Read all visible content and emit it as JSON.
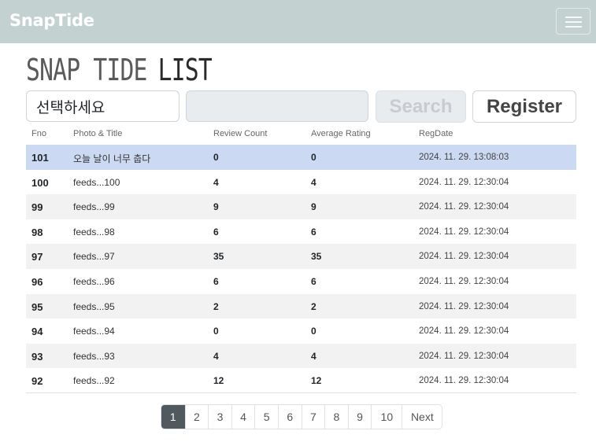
{
  "app": {
    "brand": "SnapTide"
  },
  "page": {
    "title_part1": "SNAP TIDE",
    "title_part2": "LIST"
  },
  "search": {
    "type_select_value": "선택하세요",
    "keyword_value": "",
    "search_label": "Search",
    "register_label": "Register"
  },
  "table": {
    "headers": {
      "fno": "Fno",
      "title": "Photo & Title",
      "review_count": "Review Count",
      "avg_rating": "Average Rating",
      "regdate": "RegDate"
    },
    "rows": [
      {
        "fno": "101",
        "title": "오늘 날이 너무 춥다",
        "review_count": "0",
        "avg_rating": "0",
        "regdate": "2024. 11. 29. 13:08:03",
        "selected": true
      },
      {
        "fno": "100",
        "title": "feeds...100",
        "review_count": "4",
        "avg_rating": "4",
        "regdate": "2024. 11. 29. 12:30:04"
      },
      {
        "fno": "99",
        "title": "feeds...99",
        "review_count": "9",
        "avg_rating": "9",
        "regdate": "2024. 11. 29. 12:30:04"
      },
      {
        "fno": "98",
        "title": "feeds...98",
        "review_count": "6",
        "avg_rating": "6",
        "regdate": "2024. 11. 29. 12:30:04"
      },
      {
        "fno": "97",
        "title": "feeds...97",
        "review_count": "35",
        "avg_rating": "35",
        "regdate": "2024. 11. 29. 12:30:04"
      },
      {
        "fno": "96",
        "title": "feeds...96",
        "review_count": "6",
        "avg_rating": "6",
        "regdate": "2024. 11. 29. 12:30:04"
      },
      {
        "fno": "95",
        "title": "feeds...95",
        "review_count": "2",
        "avg_rating": "2",
        "regdate": "2024. 11. 29. 12:30:04"
      },
      {
        "fno": "94",
        "title": "feeds...94",
        "review_count": "0",
        "avg_rating": "0",
        "regdate": "2024. 11. 29. 12:30:04"
      },
      {
        "fno": "93",
        "title": "feeds...93",
        "review_count": "4",
        "avg_rating": "4",
        "regdate": "2024. 11. 29. 12:30:04"
      },
      {
        "fno": "92",
        "title": "feeds...92",
        "review_count": "12",
        "avg_rating": "12",
        "regdate": "2024. 11. 29. 12:30:04"
      }
    ]
  },
  "pagination": {
    "pages": [
      "1",
      "2",
      "3",
      "4",
      "5",
      "6",
      "7",
      "8",
      "9",
      "10"
    ],
    "current": "1",
    "next_label": "Next"
  },
  "colors": {
    "navbar": "#c4d1d1",
    "selected_row": "#ccd9f2",
    "active_page": "#505a5e"
  },
  "icons": {
    "menu": "hamburger-icon"
  }
}
